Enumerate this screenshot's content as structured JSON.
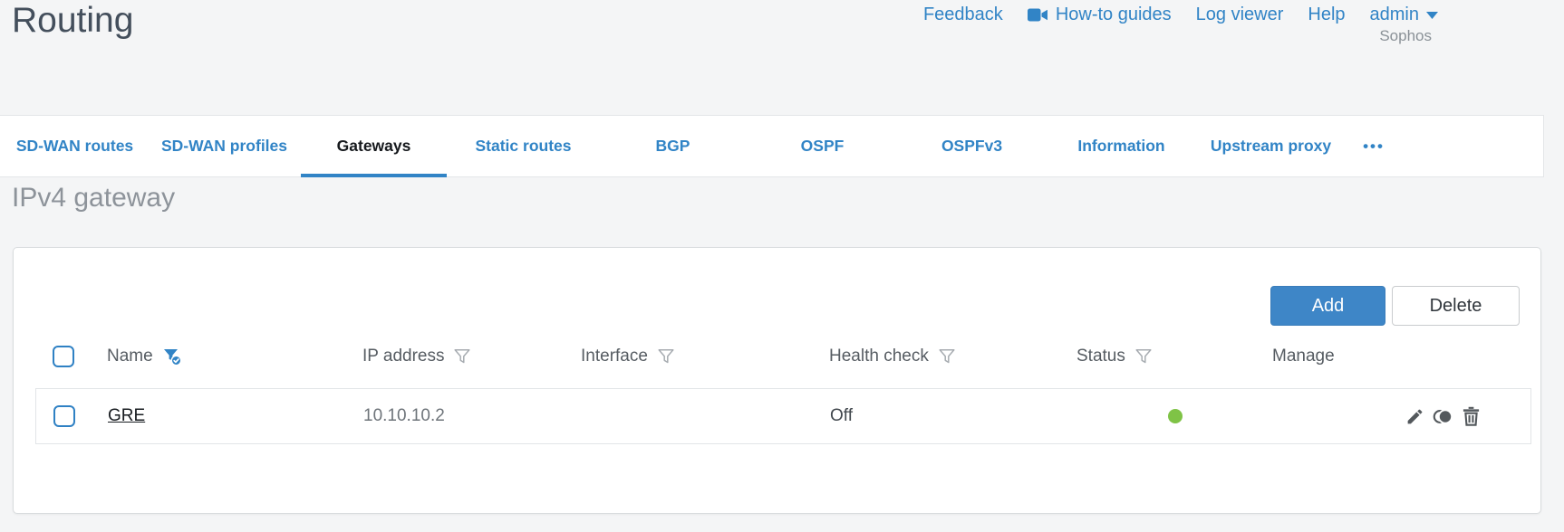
{
  "colors": {
    "accent_blue": "#3184c6",
    "status_green": "#7fc346",
    "active_tab_text": "#16191d"
  },
  "header": {
    "title": "Routing",
    "brand": "Sophos",
    "nav": [
      {
        "label": "Feedback"
      },
      {
        "label": "How-to guides",
        "icon": "video-camera-icon"
      },
      {
        "label": "Log viewer"
      },
      {
        "label": "Help"
      },
      {
        "label": "admin",
        "icon": "caret-down-icon"
      }
    ]
  },
  "tabs": {
    "items": [
      {
        "label": "SD-WAN routes",
        "active": false
      },
      {
        "label": "SD-WAN profiles",
        "active": false
      },
      {
        "label": "Gateways",
        "active": true
      },
      {
        "label": "Static routes",
        "active": false
      },
      {
        "label": "BGP",
        "active": false
      },
      {
        "label": "OSPF",
        "active": false
      },
      {
        "label": "OSPFv3",
        "active": false
      },
      {
        "label": "Information",
        "active": false
      },
      {
        "label": "Upstream proxy",
        "active": false
      }
    ],
    "more_label": "•••"
  },
  "section": {
    "title": "IPv4 gateway"
  },
  "toolbar": {
    "add_label": "Add",
    "delete_label": "Delete"
  },
  "table": {
    "columns": [
      {
        "label": "Name",
        "filter": "active"
      },
      {
        "label": "IP address",
        "filter": "default"
      },
      {
        "label": "Interface",
        "filter": "default"
      },
      {
        "label": "Health check",
        "filter": "default"
      },
      {
        "label": "Status",
        "filter": "default"
      },
      {
        "label": "Manage",
        "filter": "none"
      }
    ],
    "rows": [
      {
        "name": "GRE",
        "ip_address": "10.10.10.2",
        "interface": "",
        "health_check": "Off",
        "status": "green",
        "manage_icons": [
          "edit-icon",
          "clone-icon",
          "delete-icon"
        ]
      }
    ]
  }
}
